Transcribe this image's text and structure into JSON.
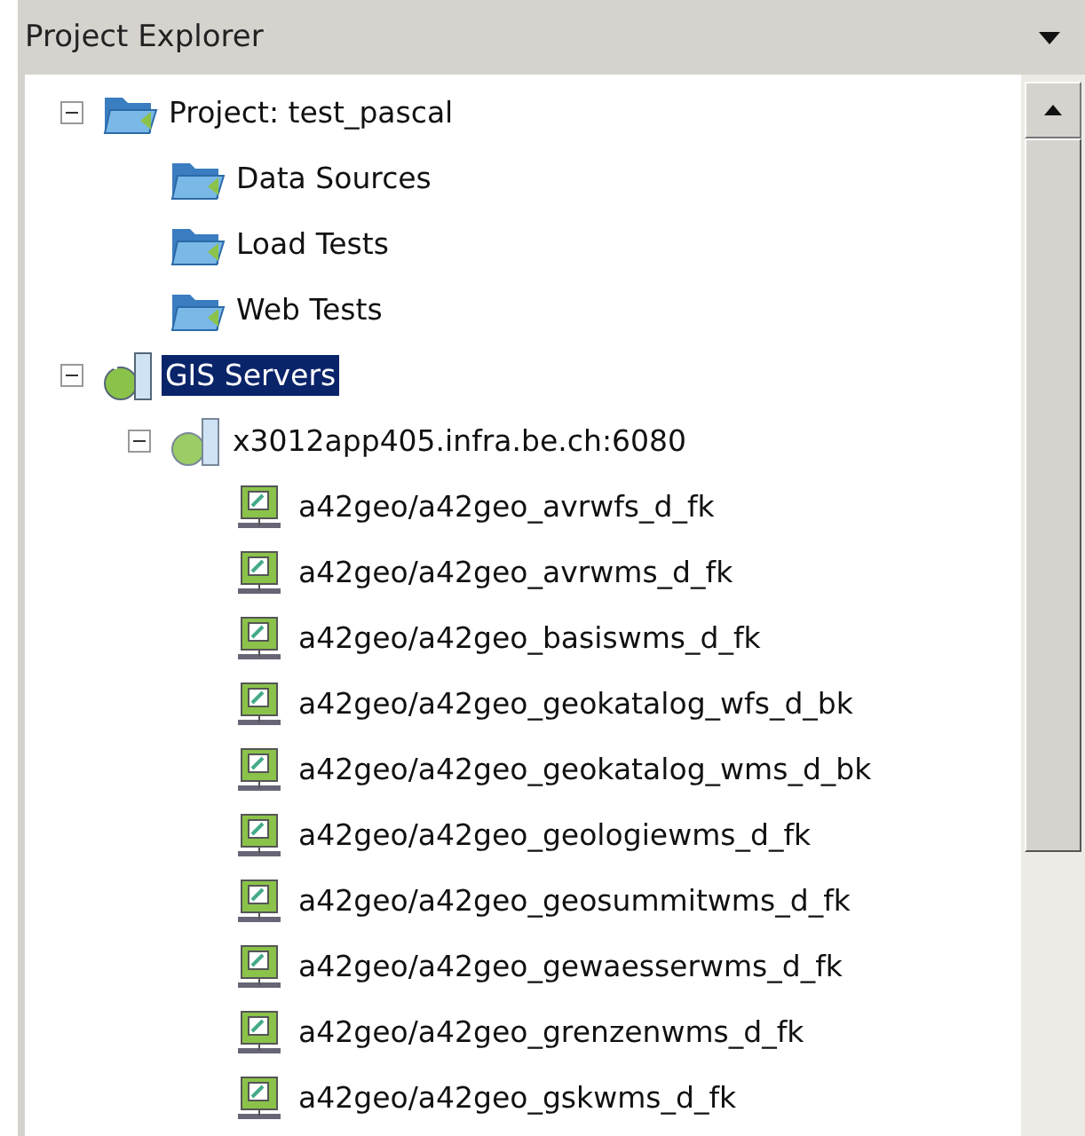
{
  "panel": {
    "title": "Project Explorer"
  },
  "tree": [
    {
      "label": "Project: test_pascal",
      "kind": "folder",
      "expanded": true,
      "selected": false,
      "children": [
        {
          "label": "Data Sources",
          "kind": "folder",
          "selected": false
        },
        {
          "label": "Load Tests",
          "kind": "folder",
          "selected": false
        },
        {
          "label": "Web Tests",
          "kind": "folder",
          "selected": false
        }
      ]
    },
    {
      "label": "GIS Servers",
      "kind": "servers",
      "expanded": true,
      "selected": true,
      "children": [
        {
          "label": "x3012app405.infra.be.ch:6080",
          "kind": "server",
          "expanded": true,
          "selected": false,
          "children": [
            {
              "label": "a42geo/a42geo_avrwfs_d_fk",
              "kind": "service",
              "selected": false
            },
            {
              "label": "a42geo/a42geo_avrwms_d_fk",
              "kind": "service",
              "selected": false
            },
            {
              "label": "a42geo/a42geo_basiswms_d_fk",
              "kind": "service",
              "selected": false
            },
            {
              "label": "a42geo/a42geo_geokatalog_wfs_d_bk",
              "kind": "service",
              "selected": false
            },
            {
              "label": "a42geo/a42geo_geokatalog_wms_d_bk",
              "kind": "service",
              "selected": false
            },
            {
              "label": "a42geo/a42geo_geologiewms_d_fk",
              "kind": "service",
              "selected": false
            },
            {
              "label": "a42geo/a42geo_geosummitwms_d_fk",
              "kind": "service",
              "selected": false
            },
            {
              "label": "a42geo/a42geo_gewaesserwms_d_fk",
              "kind": "service",
              "selected": false
            },
            {
              "label": "a42geo/a42geo_grenzenwms_d_fk",
              "kind": "service",
              "selected": false
            },
            {
              "label": "a42geo/a42geo_gskwms_d_fk",
              "kind": "service",
              "selected": false
            }
          ]
        }
      ]
    }
  ]
}
